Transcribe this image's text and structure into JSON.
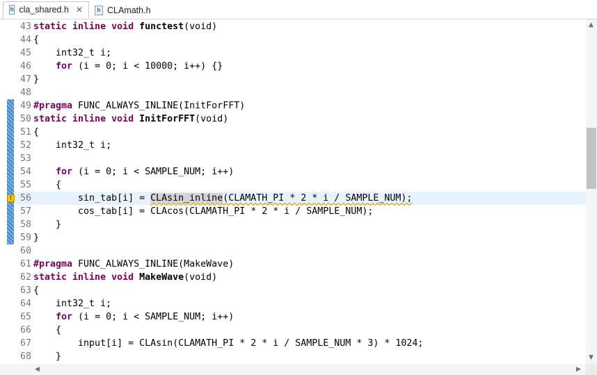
{
  "tabs": [
    {
      "label": "cla_shared.h",
      "icon": "h-file-icon",
      "active": true,
      "closable": true
    },
    {
      "label": "CLAmath.h",
      "icon": "h-file-icon",
      "active": false,
      "closable": false
    }
  ],
  "icons": {
    "file": "h",
    "close": "✕",
    "warning": "!",
    "scroll_up": "▲",
    "scroll_down": "▼",
    "scroll_left": "◀",
    "scroll_right": "▶"
  },
  "colors": {
    "keyword": "#7f0055",
    "current_line": "#e8f2fe",
    "line_number": "#787878",
    "change_bar": "#3f87c9"
  },
  "lines": [
    {
      "n": "43",
      "p": [
        {
          "t": "static inline void ",
          "c": "kw"
        },
        {
          "t": "functest",
          "c": "fn"
        },
        {
          "t": "(void)"
        }
      ]
    },
    {
      "n": "44",
      "p": [
        {
          "t": "{"
        }
      ]
    },
    {
      "n": "45",
      "p": [
        {
          "t": "    int32_t i;"
        }
      ]
    },
    {
      "n": "46",
      "p": [
        {
          "t": "    "
        },
        {
          "t": "for",
          "c": "kw"
        },
        {
          "t": " (i = 0; i < 10000; i++) {}"
        }
      ]
    },
    {
      "n": "47",
      "p": [
        {
          "t": "}"
        }
      ]
    },
    {
      "n": "48",
      "p": [
        {
          "t": ""
        }
      ]
    },
    {
      "n": "49",
      "p": [
        {
          "t": "#pragma",
          "c": "kw"
        },
        {
          "t": " FUNC_ALWAYS_INLINE(InitForFFT)"
        }
      ]
    },
    {
      "n": "50",
      "p": [
        {
          "t": "static inline void ",
          "c": "kw"
        },
        {
          "t": "InitForFFT",
          "c": "fn"
        },
        {
          "t": "(void)"
        }
      ]
    },
    {
      "n": "51",
      "p": [
        {
          "t": "{"
        }
      ]
    },
    {
      "n": "52",
      "p": [
        {
          "t": "    int32_t i;"
        }
      ]
    },
    {
      "n": "53",
      "p": [
        {
          "t": ""
        }
      ]
    },
    {
      "n": "54",
      "p": [
        {
          "t": "    "
        },
        {
          "t": "for",
          "c": "kw"
        },
        {
          "t": " (i = 0; i < SAMPLE_NUM; i++)"
        }
      ]
    },
    {
      "n": "55",
      "p": [
        {
          "t": "    {"
        }
      ]
    },
    {
      "n": "56",
      "current": true,
      "warning": true,
      "p": [
        {
          "t": "        sin_tab[i] = "
        },
        {
          "t": "CLAsin_inline",
          "c": "hl warn-underline"
        },
        {
          "t": "(CLAMATH_PI * 2 * i / SAMPLE_NUM);",
          "c": "warn-underline"
        }
      ]
    },
    {
      "n": "57",
      "p": [
        {
          "t": "        cos_tab[i] = CLAcos(CLAMATH_PI * 2 * i / SAMPLE_NUM);"
        }
      ]
    },
    {
      "n": "58",
      "p": [
        {
          "t": "    }"
        }
      ]
    },
    {
      "n": "59",
      "p": [
        {
          "t": "}"
        }
      ]
    },
    {
      "n": "60",
      "p": [
        {
          "t": ""
        }
      ]
    },
    {
      "n": "61",
      "p": [
        {
          "t": "#pragma",
          "c": "kw"
        },
        {
          "t": " FUNC_ALWAYS_INLINE(MakeWave)"
        }
      ]
    },
    {
      "n": "62",
      "p": [
        {
          "t": "static inline void ",
          "c": "kw"
        },
        {
          "t": "MakeWave",
          "c": "fn"
        },
        {
          "t": "(void)"
        }
      ]
    },
    {
      "n": "63",
      "p": [
        {
          "t": "{"
        }
      ]
    },
    {
      "n": "64",
      "p": [
        {
          "t": "    int32_t i;"
        }
      ]
    },
    {
      "n": "65",
      "p": [
        {
          "t": "    "
        },
        {
          "t": "for",
          "c": "kw"
        },
        {
          "t": " (i = 0; i < SAMPLE_NUM; i++)"
        }
      ]
    },
    {
      "n": "66",
      "p": [
        {
          "t": "    {"
        }
      ]
    },
    {
      "n": "67",
      "p": [
        {
          "t": "        input[i] = CLAsin(CLAMATH_PI * 2 * i / SAMPLE_NUM * 3) * 1024;"
        }
      ]
    },
    {
      "n": "68",
      "p": [
        {
          "t": "    }"
        }
      ]
    }
  ]
}
